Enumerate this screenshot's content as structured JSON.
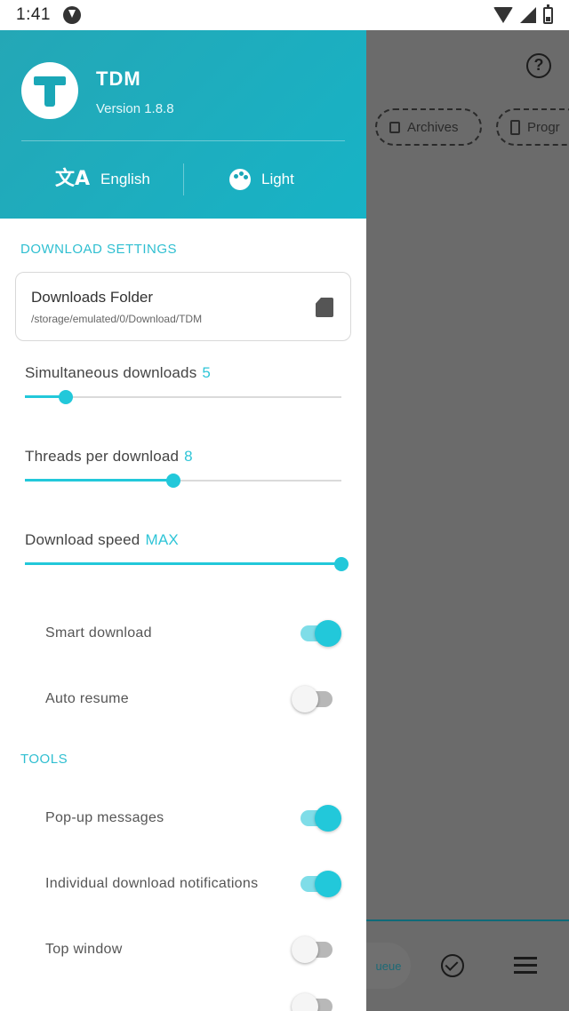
{
  "status_bar": {
    "time": "1:41"
  },
  "background_app": {
    "chips": [
      {
        "label": "Archives"
      },
      {
        "label": "Progr"
      }
    ],
    "bottom_nav": {
      "queue_label": "ueue"
    }
  },
  "drawer": {
    "header": {
      "app_name": "TDM",
      "version": "Version 1.8.8",
      "language_label": "English",
      "theme_label": "Light"
    },
    "download_settings": {
      "section_title": "DOWNLOAD SETTINGS",
      "folder_title": "Downloads Folder",
      "folder_path": "/storage/emulated/0/Download/TDM",
      "sliders": [
        {
          "label": "Simultaneous downloads",
          "value": "5",
          "fraction": 0.13
        },
        {
          "label": "Threads per download",
          "value": "8",
          "fraction": 0.47
        },
        {
          "label": "Download speed",
          "value": "MAX",
          "fraction": 1.0
        }
      ],
      "toggles": [
        {
          "label": "Smart download",
          "on": true
        },
        {
          "label": "Auto resume",
          "on": false
        }
      ]
    },
    "tools": {
      "section_title": "TOOLS",
      "toggles": [
        {
          "label": "Pop-up messages",
          "on": true
        },
        {
          "label": "Individual download notifications",
          "on": true
        },
        {
          "label": "Top window",
          "on": false
        },
        {
          "label": "",
          "on": false
        }
      ]
    }
  },
  "colors": {
    "accent": "#22c8da",
    "header": "#17b3c6",
    "scrim": "#6b6b6b"
  }
}
